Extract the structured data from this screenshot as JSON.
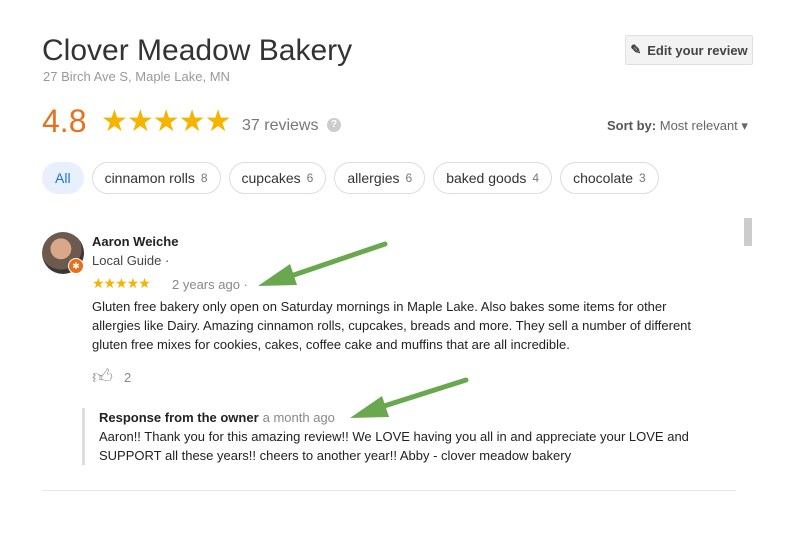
{
  "place": {
    "title": "Clover Meadow Bakery",
    "address": "27 Birch Ave S, Maple Lake, MN",
    "rating": "4.8",
    "stars": "★★★★★",
    "review_count": "37 reviews",
    "help_icon": "?"
  },
  "edit_button": {
    "label": "Edit your review",
    "icon": "pencil-icon"
  },
  "sort": {
    "label": "Sort by:",
    "value": "Most relevant",
    "icon": "▾"
  },
  "chips": [
    {
      "label": "All"
    },
    {
      "label": "cinnamon rolls",
      "count": "8"
    },
    {
      "label": "cupcakes",
      "count": "6"
    },
    {
      "label": "allergies",
      "count": "6"
    },
    {
      "label": "baked goods",
      "count": "4"
    },
    {
      "label": "chocolate",
      "count": "3"
    }
  ],
  "review": {
    "author": "Aaron Weiche",
    "subtitle": "Local Guide ·",
    "stars": "★★★★★",
    "rating": 5,
    "time": "2 years ago ·",
    "text": "Gluten free bakery only open on Saturday mornings in Maple Lake. Also bakes some items for other allergies like Dairy.  Amazing cinnamon rolls, cupcakes, breads and more.  They sell a number of different gluten free mixes for cookies, cakes, coffee cake and muffins that are all incredible.",
    "likes": "2",
    "response": {
      "heading": "Response from the owner",
      "time": "a month ago",
      "text": "Aaron!! Thank you for this amazing review!! We LOVE having you all in and appreciate your LOVE and SUPPORT all these years!! cheers to another year!! Abby - clover meadow bakery"
    }
  },
  "colors": {
    "rating": "#e7711b",
    "star": "#f4b400",
    "arrow": "#6aa84f",
    "chip_active": "#1a73e8"
  }
}
